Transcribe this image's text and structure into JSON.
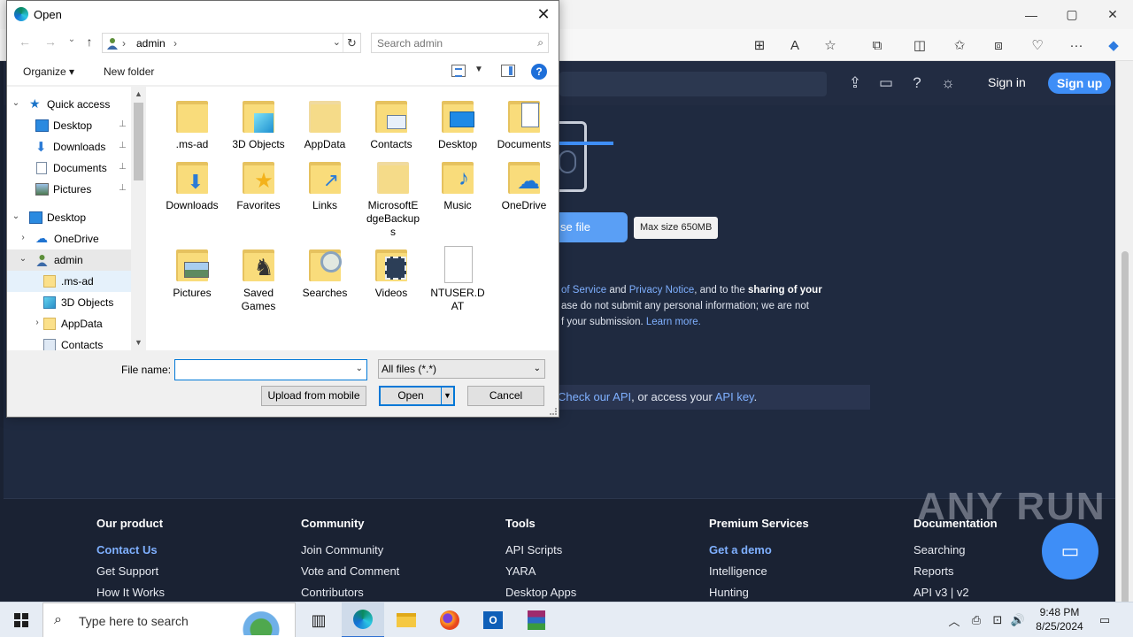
{
  "dialog": {
    "title": "Open",
    "close_label": "✕",
    "address": {
      "crumb_user": "admin",
      "sep1": "›",
      "sep2": "›"
    },
    "search_placeholder": "Search admin",
    "commands": {
      "organize": "Organize ▾",
      "new_folder": "New folder",
      "help": "?"
    },
    "tree": [
      {
        "label": "Quick access",
        "expander": "⌄",
        "icon": "star-icon",
        "pinned": false
      },
      {
        "label": "Desktop",
        "expander": "",
        "icon": "desktop-icon",
        "pinned": true
      },
      {
        "label": "Downloads",
        "expander": "",
        "icon": "download-icon",
        "pinned": true
      },
      {
        "label": "Documents",
        "expander": "",
        "icon": "documents-icon",
        "pinned": true
      },
      {
        "label": "Pictures",
        "expander": "",
        "icon": "pictures-icon",
        "pinned": true
      },
      {
        "label": "Desktop",
        "expander": "⌄",
        "icon": "desktop-icon",
        "pinned": false
      },
      {
        "label": "OneDrive",
        "expander": "›",
        "icon": "onedrive-icon",
        "pinned": false
      },
      {
        "label": "admin",
        "expander": "⌄",
        "icon": "user-icon",
        "pinned": false
      },
      {
        "label": ".ms-ad",
        "expander": "",
        "icon": "folder-icon",
        "pinned": false
      },
      {
        "label": "3D Objects",
        "expander": "",
        "icon": "3d-objects-icon",
        "pinned": false
      },
      {
        "label": "AppData",
        "expander": "›",
        "icon": "folder-icon",
        "pinned": false
      },
      {
        "label": "Contacts",
        "expander": "",
        "icon": "contacts-icon",
        "pinned": false
      }
    ],
    "pin_glyph": "📌",
    "files": [
      {
        "name": ".ms-ad",
        "icon": "folder-icon",
        "type": "folder"
      },
      {
        "name": "3D Objects",
        "icon": "3d-objects-icon",
        "type": "folder"
      },
      {
        "name": "AppData",
        "icon": "folder-icon",
        "type": "folder"
      },
      {
        "name": "Contacts",
        "icon": "contacts-icon",
        "type": "folder"
      },
      {
        "name": "Desktop",
        "icon": "desktop-icon",
        "type": "folder"
      },
      {
        "name": "Documents",
        "icon": "documents-icon",
        "type": "folder"
      },
      {
        "name": "Downloads",
        "icon": "download-icon",
        "type": "folder"
      },
      {
        "name": "Favorites",
        "icon": "favorites-star-icon",
        "type": "folder"
      },
      {
        "name": "Links",
        "icon": "link-arrow-icon",
        "type": "folder"
      },
      {
        "name": "MicrosoftEdgeBackups",
        "icon": "folder-icon",
        "type": "folder"
      },
      {
        "name": "Music",
        "icon": "music-note-icon",
        "type": "folder"
      },
      {
        "name": "OneDrive",
        "icon": "onedrive-icon",
        "type": "folder"
      },
      {
        "name": "Pictures",
        "icon": "pictures-icon",
        "type": "folder"
      },
      {
        "name": "Saved Games",
        "icon": "chess-piece-icon",
        "type": "folder"
      },
      {
        "name": "Searches",
        "icon": "magnifier-icon",
        "type": "folder"
      },
      {
        "name": "Videos",
        "icon": "film-icon",
        "type": "folder"
      },
      {
        "name": "NTUSER.DAT",
        "icon": "file-icon",
        "type": "file"
      }
    ],
    "file_name_label": "File name:",
    "file_name_value": "",
    "file_type": "All files (*.*)",
    "upload_mobile": "Upload from mobile",
    "open": "Open",
    "cancel": "Cancel"
  },
  "browser": {
    "window_controls": {
      "minimize": "—",
      "maximize": "▢",
      "close": "✕"
    },
    "toolbar_icons": [
      "apps-icon",
      "read-aloud-icon",
      "favorite-star-icon",
      "extensions-icon",
      "split-screen-icon",
      "favorites-icon",
      "collections-icon",
      "browser-essentials-icon",
      "more-icon",
      "copilot-icon"
    ]
  },
  "site": {
    "signin": "Sign in",
    "signup": "Sign up",
    "choose_file": "se file",
    "max_size": "Max size 650MB",
    "terms": {
      "p1": "of Service",
      "p2": " and ",
      "p3": "Privacy Notice",
      "p4": ", and to the ",
      "p5": "sharing of your",
      "line2": "ase do not submit any personal information; we are not",
      "line3a": "f your submission. ",
      "line3b": "Learn more."
    },
    "api": {
      "a": "Check our API",
      "b": ", or access your ",
      "c": "API key",
      "d": "."
    },
    "footer": [
      {
        "heading": "Our product",
        "items": [
          {
            "t": "Contact Us",
            "hl": true
          },
          {
            "t": "Get Support",
            "hl": false
          },
          {
            "t": "How It Works",
            "hl": false
          }
        ]
      },
      {
        "heading": "Community",
        "items": [
          {
            "t": "Join Community",
            "hl": false
          },
          {
            "t": "Vote and Comment",
            "hl": false
          },
          {
            "t": "Contributors",
            "hl": false
          }
        ]
      },
      {
        "heading": "Tools",
        "items": [
          {
            "t": "API Scripts",
            "hl": false
          },
          {
            "t": "YARA",
            "hl": false
          },
          {
            "t": "Desktop Apps",
            "hl": false
          }
        ]
      },
      {
        "heading": "Premium Services",
        "items": [
          {
            "t": "Get a demo",
            "hl": true
          },
          {
            "t": "Intelligence",
            "hl": false
          },
          {
            "t": "Hunting",
            "hl": false
          }
        ]
      },
      {
        "heading": "Documentation",
        "items": [
          {
            "t": "Searching",
            "hl": false
          },
          {
            "t": "Reports",
            "hl": false
          },
          {
            "t": "API v3 | v2",
            "hl": false
          }
        ]
      }
    ],
    "watermark": "ANY RUN"
  },
  "taskbar": {
    "search_placeholder": "Type here to search",
    "apps": [
      "task-view-icon",
      "edge-icon",
      "file-explorer-icon",
      "firefox-icon",
      "outlook-icon",
      "winrar-icon"
    ],
    "time": "9:48 PM",
    "date": "8/25/2024"
  }
}
